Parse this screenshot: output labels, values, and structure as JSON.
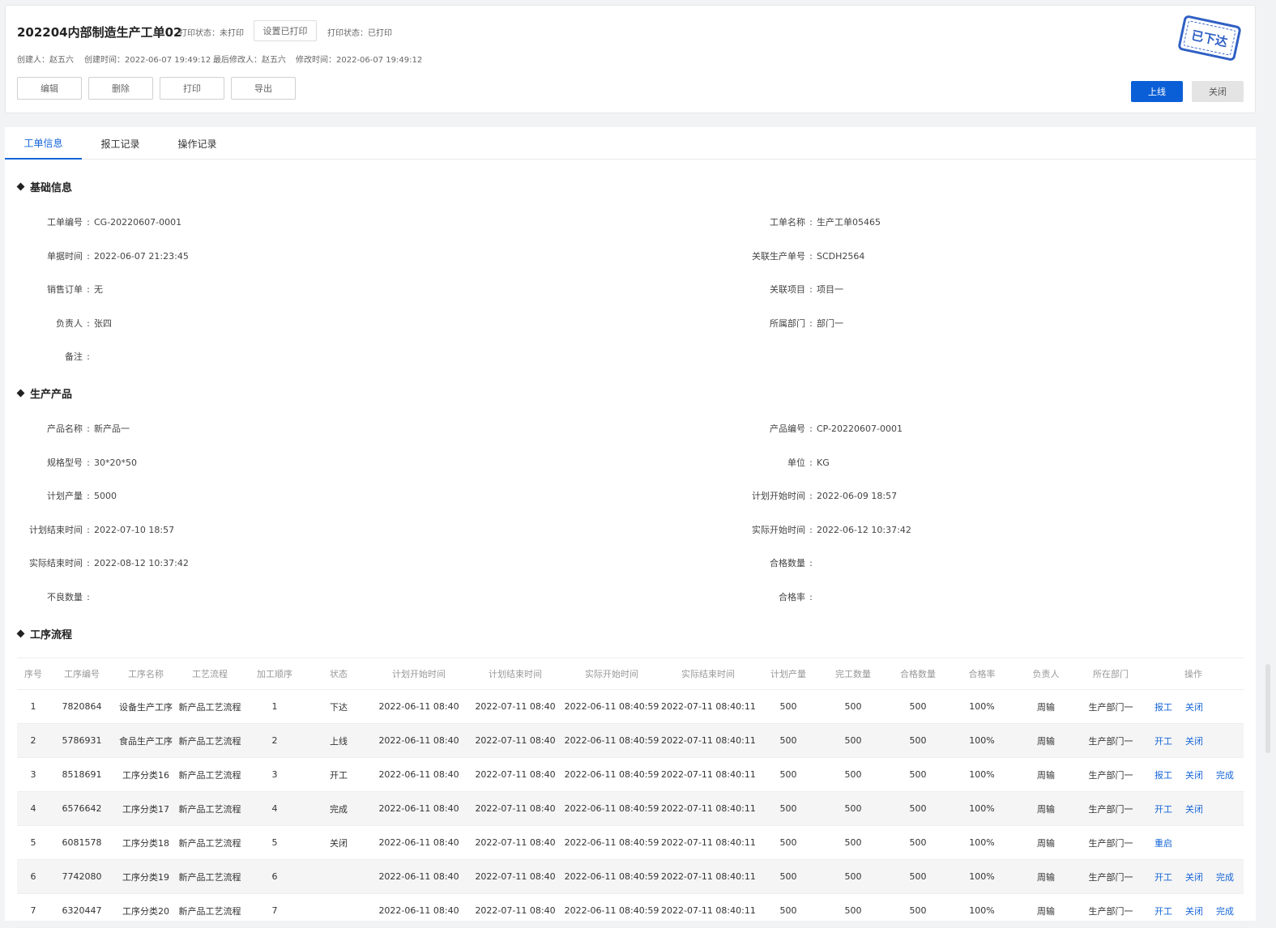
{
  "header": {
    "title": "202204内部制造生产工单02",
    "print_status_1": "打印状态：未打印",
    "set_printed_label": "设置已打印",
    "print_status_2": "打印状态：已打印",
    "meta": {
      "creator": "创建人：赵五六",
      "created_time": "创建时间：2022-06-07 19:49:12",
      "last_modifier": "最后修改人：赵五六",
      "modified_time": "修改时间：2022-06-07 19:49:12"
    },
    "buttons": {
      "edit": "编辑",
      "delete": "删除",
      "print": "打印",
      "export": "导出"
    },
    "stamp": "已下达",
    "online_label": "上线",
    "close_label": "关闭"
  },
  "tabs": [
    "工单信息",
    "报工记录",
    "操作记录"
  ],
  "basic_info": {
    "title": "基础信息",
    "left": [
      {
        "label": "工单编号",
        "value": "CG-20220607-0001"
      },
      {
        "label": "单据时间",
        "value": "2022-06-07 21:23:45"
      },
      {
        "label": "销售订单",
        "value": "无"
      },
      {
        "label": "负责人",
        "value": "张四"
      },
      {
        "label": "备注",
        "value": ""
      }
    ],
    "right": [
      {
        "label": "工单名称",
        "value": "生产工单05465"
      },
      {
        "label": "关联生产单号",
        "value": "SCDH2564"
      },
      {
        "label": "关联项目",
        "value": "项目一"
      },
      {
        "label": "所属部门",
        "value": "部门一"
      }
    ]
  },
  "product": {
    "title": "生产产品",
    "left": [
      {
        "label": "产品名称",
        "value": "新产品一"
      },
      {
        "label": "规格型号",
        "value": "30*20*50"
      },
      {
        "label": "计划产量",
        "value": "5000"
      },
      {
        "label": "计划结束时间",
        "value": "2022-07-10 18:57"
      },
      {
        "label": "实际结束时间",
        "value": "2022-08-12 10:37:42"
      },
      {
        "label": "不良数量",
        "value": ""
      }
    ],
    "right": [
      {
        "label": "产品编号",
        "value": "CP-20220607-0001"
      },
      {
        "label": "单位",
        "value": "KG"
      },
      {
        "label": "计划开始时间",
        "value": "2022-06-09 18:57"
      },
      {
        "label": "实际开始时间",
        "value": "2022-06-12 10:37:42"
      },
      {
        "label": "合格数量",
        "value": ""
      },
      {
        "label": "合格率",
        "value": ""
      }
    ]
  },
  "process": {
    "title": "工序流程",
    "columns": [
      "序号",
      "工序编号",
      "工序名称",
      "工艺流程",
      "加工顺序",
      "状态",
      "计划开始时间",
      "计划结束时间",
      "实际开始时间",
      "实际结束时间",
      "计划产量",
      "完工数量",
      "合格数量",
      "合格率",
      "负责人",
      "所在部门",
      "操作"
    ],
    "rows": [
      {
        "no": "1",
        "code": "7820864",
        "name": "设备生产工序",
        "flow": "新产品工艺流程",
        "order": "1",
        "status": "下达",
        "plan_start": "2022-06-11 08:40",
        "plan_end": "2022-07-11 08:40",
        "act_start": "2022-06-11 08:40:59",
        "act_end": "2022-07-11 08:40:11",
        "plan_qty": "500",
        "done_qty": "500",
        "pass_qty": "500",
        "rate": "100%",
        "owner": "周输",
        "dept": "生产部门一",
        "ops": [
          "报工",
          "关闭"
        ]
      },
      {
        "no": "2",
        "code": "5786931",
        "name": "食品生产工序",
        "flow": "新产品工艺流程",
        "order": "2",
        "status": "上线",
        "plan_start": "2022-06-11 08:40",
        "plan_end": "2022-07-11 08:40",
        "act_start": "2022-06-11 08:40:59",
        "act_end": "2022-07-11 08:40:11",
        "plan_qty": "500",
        "done_qty": "500",
        "pass_qty": "500",
        "rate": "100%",
        "owner": "周输",
        "dept": "生产部门一",
        "ops": [
          "开工",
          "关闭"
        ]
      },
      {
        "no": "3",
        "code": "8518691",
        "name": "工序分类16",
        "flow": "新产品工艺流程",
        "order": "3",
        "status": "开工",
        "plan_start": "2022-06-11 08:40",
        "plan_end": "2022-07-11 08:40",
        "act_start": "2022-06-11 08:40:59",
        "act_end": "2022-07-11 08:40:11",
        "plan_qty": "500",
        "done_qty": "500",
        "pass_qty": "500",
        "rate": "100%",
        "owner": "周输",
        "dept": "生产部门一",
        "ops": [
          "报工",
          "关闭",
          "完成"
        ]
      },
      {
        "no": "4",
        "code": "6576642",
        "name": "工序分类17",
        "flow": "新产品工艺流程",
        "order": "4",
        "status": "完成",
        "plan_start": "2022-06-11 08:40",
        "plan_end": "2022-07-11 08:40",
        "act_start": "2022-06-11 08:40:59",
        "act_end": "2022-07-11 08:40:11",
        "plan_qty": "500",
        "done_qty": "500",
        "pass_qty": "500",
        "rate": "100%",
        "owner": "周输",
        "dept": "生产部门一",
        "ops": [
          "开工",
          "关闭"
        ]
      },
      {
        "no": "5",
        "code": "6081578",
        "name": "工序分类18",
        "flow": "新产品工艺流程",
        "order": "5",
        "status": "关闭",
        "plan_start": "2022-06-11 08:40",
        "plan_end": "2022-07-11 08:40",
        "act_start": "2022-06-11 08:40:59",
        "act_end": "2022-07-11 08:40:11",
        "plan_qty": "500",
        "done_qty": "500",
        "pass_qty": "500",
        "rate": "100%",
        "owner": "周输",
        "dept": "生产部门一",
        "ops": [
          "重启"
        ]
      },
      {
        "no": "6",
        "code": "7742080",
        "name": "工序分类19",
        "flow": "新产品工艺流程",
        "order": "6",
        "status": "",
        "plan_start": "2022-06-11 08:40",
        "plan_end": "2022-07-11 08:40",
        "act_start": "2022-06-11 08:40:59",
        "act_end": "2022-07-11 08:40:11",
        "plan_qty": "500",
        "done_qty": "500",
        "pass_qty": "500",
        "rate": "100%",
        "owner": "周输",
        "dept": "生产部门一",
        "ops": [
          "开工",
          "关闭",
          "完成"
        ]
      },
      {
        "no": "7",
        "code": "6320447",
        "name": "工序分类20",
        "flow": "新产品工艺流程",
        "order": "7",
        "status": "",
        "plan_start": "2022-06-11 08:40",
        "plan_end": "2022-07-11 08:40",
        "act_start": "2022-06-11 08:40:59",
        "act_end": "2022-07-11 08:40:11",
        "plan_qty": "500",
        "done_qty": "500",
        "pass_qty": "500",
        "rate": "100%",
        "owner": "周输",
        "dept": "生产部门一",
        "ops": [
          "开工",
          "关闭",
          "完成"
        ]
      }
    ]
  },
  "colors": {
    "primary": "#0b5fd6",
    "link": "#1565d8",
    "stamp": "#2f5fc4"
  }
}
